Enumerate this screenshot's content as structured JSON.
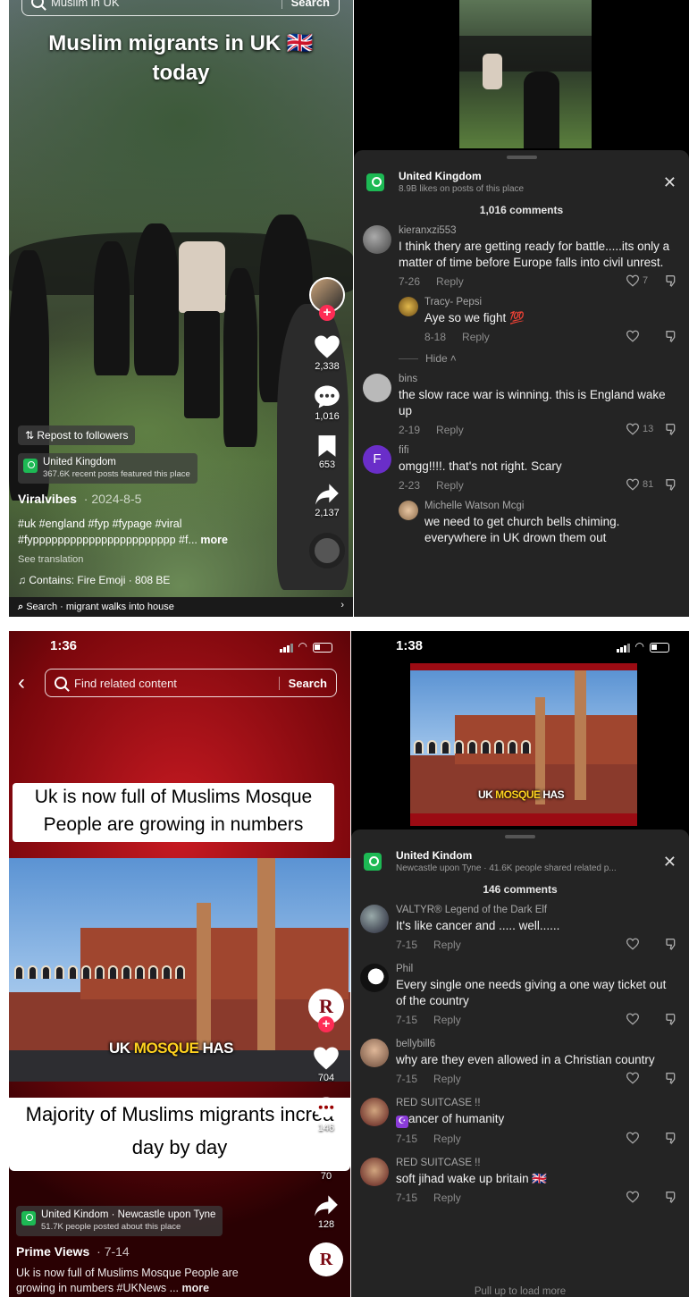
{
  "panel1": {
    "search_placeholder": "Muslim in UK",
    "search_button": "Search",
    "overlay_title_line1": "Muslim migrants in UK 🇬🇧",
    "overlay_title_line2": "today",
    "likes": "2,338",
    "comments": "1,016",
    "saves": "653",
    "shares": "2,137",
    "repost_label": "Repost to followers",
    "location": "United Kingdom",
    "location_sub": "367.6K recent posts featured this place",
    "author": "Viralvibes",
    "date": "· 2024-8-5",
    "hashtags_line1": "#uk #england #fyp #fypage #viral",
    "hashtags_line2": "#fyppppppppppppppppppppppp #f...",
    "more": "more",
    "see_translation": "See translation",
    "sound": "Contains: Fire Emoji · 808 BE",
    "bottom_search": "Search · migrant walks into house"
  },
  "panel2": {
    "sheet_title": "United Kingdom",
    "sheet_sub": "8.9B likes on posts of this place",
    "count": "1,016 comments",
    "hide": "Hide",
    "comments": [
      {
        "user": "kieranxzi553",
        "text": "I think thery are getting ready for battle.....its only a matter of time before Europe falls into civil unrest.",
        "date": "7-26",
        "reply": "Reply",
        "likes": "7"
      },
      {
        "user": "Tracy- Pepsi",
        "text": "Aye so we fight 💯",
        "date": "8-18",
        "reply": "Reply",
        "likes": ""
      },
      {
        "user": "bins",
        "text": "the slow race war is winning. this is England wake up",
        "date": "2-19",
        "reply": "Reply",
        "likes": "13"
      },
      {
        "user": "fifi",
        "initial": "F",
        "text": "omgg!!!!. that's not right. Scary",
        "date": "2-23",
        "reply": "Reply",
        "likes": "81"
      },
      {
        "user": "Michelle Watson Mcgi",
        "text": "we need to get church bells chiming. everywhere in UK drown them out",
        "date": "",
        "reply": "",
        "likes": ""
      }
    ]
  },
  "panel3": {
    "time": "1:36",
    "search_placeholder": "Find related content",
    "search_button": "Search",
    "caption_line1": "Uk is now full of Muslims Mosque",
    "caption_line2": "People are growing in numbers",
    "video_caption_a": "UK ",
    "video_caption_b": "MOSQUE",
    "video_caption_c": " HAS",
    "caption2_line1": "Majority of Muslims migrants increa",
    "caption2_line2": "day by day",
    "likes": "704",
    "comments": "146",
    "saves": "70",
    "shares": "128",
    "location": "United Kindom · Newcastle upon Tyne",
    "location_sub": "51.7K people posted about this place",
    "author": "Prime Views",
    "date": "· 7-14",
    "desc_line1": "Uk is now full of Muslims Mosque  People are",
    "desc_line2": "growing in numbers  #UKNews ...",
    "more": "more",
    "avatar_letter": "R"
  },
  "panel4": {
    "time": "1:38",
    "video_caption_a": "UK ",
    "video_caption_b": "MOSQUE",
    "video_caption_c": " HAS",
    "sheet_title": "United Kindom",
    "sheet_sub": "Newcastle upon Tyne · 41.6K people shared related p...",
    "count": "146 comments",
    "pull_up": "Pull up to load more",
    "comments": [
      {
        "user": "VALTYR® Legend of the Dark Elf",
        "text": "It's like cancer and ..... well......",
        "date": "7-15",
        "reply": "Reply"
      },
      {
        "user": "Phil",
        "text": "Every single one needs giving a one way ticket out of the country",
        "date": "7-15",
        "reply": "Reply"
      },
      {
        "user": "bellybill6",
        "text": "why are they even allowed in a Christian country",
        "date": "7-15",
        "reply": "Reply"
      },
      {
        "user": "RED SUITCASE !!",
        "text": "ancer of humanity",
        "date": "7-15",
        "reply": "Reply"
      },
      {
        "user": "RED SUITCASE !!",
        "text": "soft jihad wake up britain 🇬🇧",
        "date": "7-15",
        "reply": "Reply"
      }
    ]
  },
  "colors": {
    "accent": "#fe2c55",
    "location_green": "#1db954",
    "sheet": "#242424",
    "caption_yellow": "#ffd21f"
  }
}
